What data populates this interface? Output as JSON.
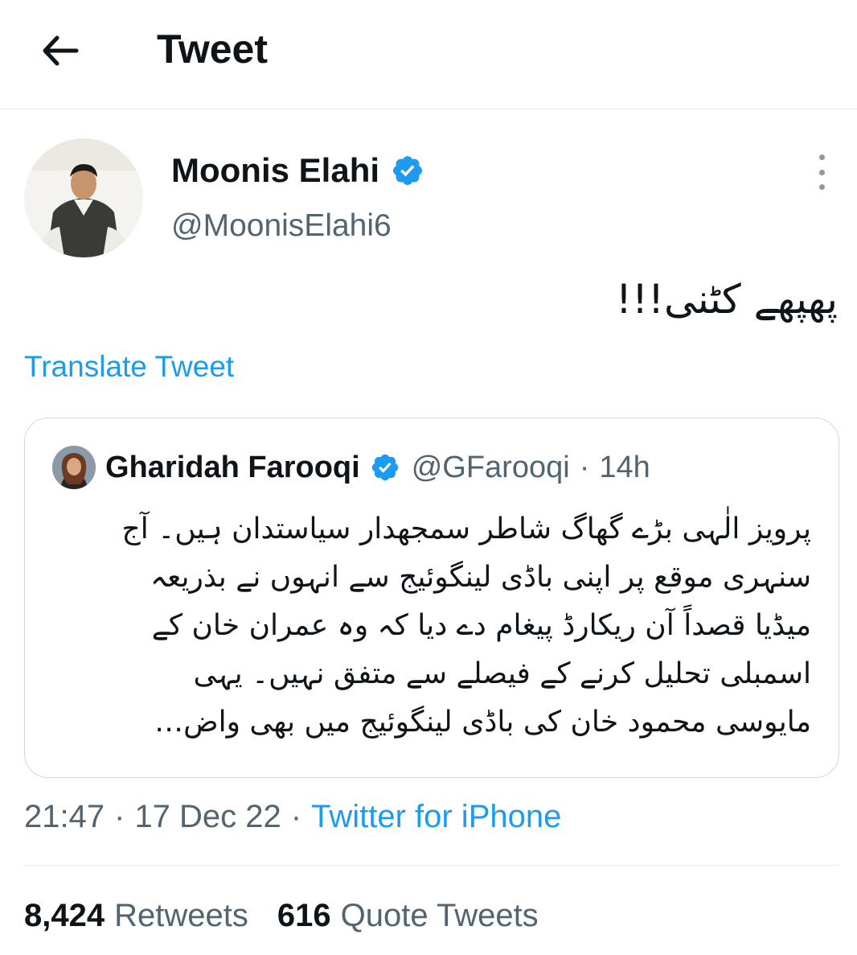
{
  "header": {
    "title": "Tweet",
    "back_icon": "arrow-left-icon"
  },
  "author": {
    "name": "Moonis Elahi",
    "handle": "@MoonisElahi6",
    "verified": true
  },
  "tweet": {
    "text": "پھپھے کٹنی!!!",
    "translate_label": "Translate Tweet"
  },
  "quoted": {
    "name": "Gharidah Farooqi",
    "handle": "@GFarooqi",
    "separator": "·",
    "time": "14h",
    "verified": true,
    "lines": [
      "پرویز الٰہی بڑے گھاگ شاطر سمجھدار سیاستدان ہیں۔ آج",
      "سنہری موقع پر اپنی باڈی لینگوئیج سے انہوں نے بذریعہ",
      "میڈیا قصداً آن ریکارڈ پیغام دے دیا کہ وہ عمران خان کے",
      "اسمبلی تحلیل کرنے کے فیصلے سے متفق نہیں۔ یہی",
      "مایوسی محمود خان کی باڈی لینگوئیج میں بھی واض…"
    ]
  },
  "meta": {
    "time": "21:47",
    "separator": "·",
    "date": "17 Dec 22",
    "source": "Twitter for iPhone"
  },
  "stats": {
    "retweets_count": "8,424",
    "retweets_label": "Retweets",
    "quotes_count": "616",
    "quotes_label": "Quote Tweets"
  },
  "colors": {
    "link": "#1d9bf0",
    "secondary_text": "#536471",
    "border": "#cfd9de",
    "verified": "#1d9bf0"
  }
}
